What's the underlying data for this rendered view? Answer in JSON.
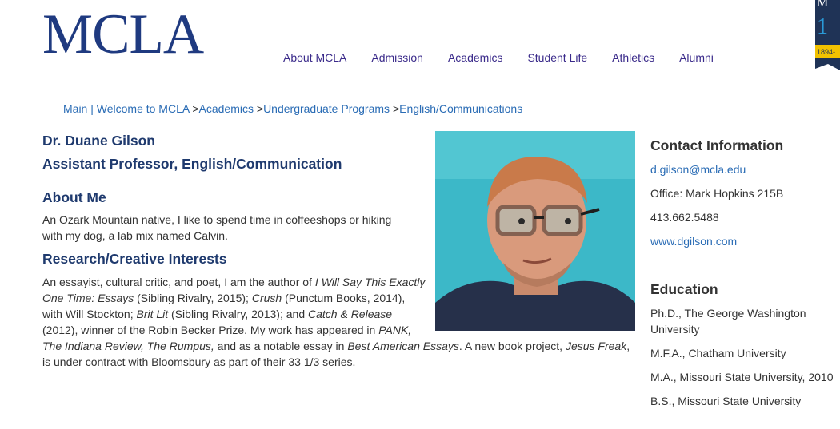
{
  "logo": {
    "text": "MCLA"
  },
  "seal": {
    "letter": "M",
    "year": "1894-"
  },
  "nav": {
    "items": [
      "About MCLA",
      "Admission",
      "Academics",
      "Student Life",
      "Athletics",
      "Alumni"
    ]
  },
  "breadcrumb": {
    "home": "Main | Welcome to MCLA",
    "sep": ">",
    "items": [
      "Academics",
      "Undergraduate Programs",
      "English/Communications"
    ]
  },
  "profile": {
    "name": "Dr. Duane Gilson",
    "title": "Assistant Professor, English/Communication"
  },
  "about": {
    "heading": "About Me",
    "text": "An Ozark Mountain native, I like to spend time in coffeeshops or hiking with my dog, a lab mix named Calvin."
  },
  "research": {
    "heading": "Research/Creative Interests",
    "t1": "An essayist, cultural critic, and poet, I am the author of ",
    "i1": "I Will Say This Exactly One Time: Essays",
    "t2": " (Sibling Rivalry, 2015); ",
    "i2": "Crush",
    "t3": " (Punctum Books, 2014), with Will Stockton; ",
    "i3": "Brit Lit",
    "t4": " (Sibling Rivalry, 2013); and ",
    "i4": "Catch & Release",
    "t5": " (2012), winner of the Robin Becker Prize. My work has appeared in ",
    "i5": "PANK, The Indiana Review, The Rumpus,",
    "t6": " and as a notable essay in ",
    "i6": "Best American Essays",
    "t7": ". A new book project, ",
    "i7": "Jesus Freak",
    "t8": ", is under contract with Bloomsbury as part of their 33 1/3 series."
  },
  "contact": {
    "heading": "Contact Information",
    "email": "d.gilson@mcla.edu",
    "office": "Office: Mark Hopkins 215B",
    "phone": "413.662.5488",
    "website": "www.dgilson.com"
  },
  "education": {
    "heading": "Education",
    "items": [
      "Ph.D., The George Washington University",
      "M.F.A., Chatham University",
      "M.A., Missouri State University, 2010",
      "B.S., Missouri State University"
    ]
  },
  "colors": {
    "brand_navy": "#1f3a80",
    "nav_purple": "#3a2a8a",
    "link_blue": "#2a6cb5",
    "seal_gold": "#f2c200"
  }
}
